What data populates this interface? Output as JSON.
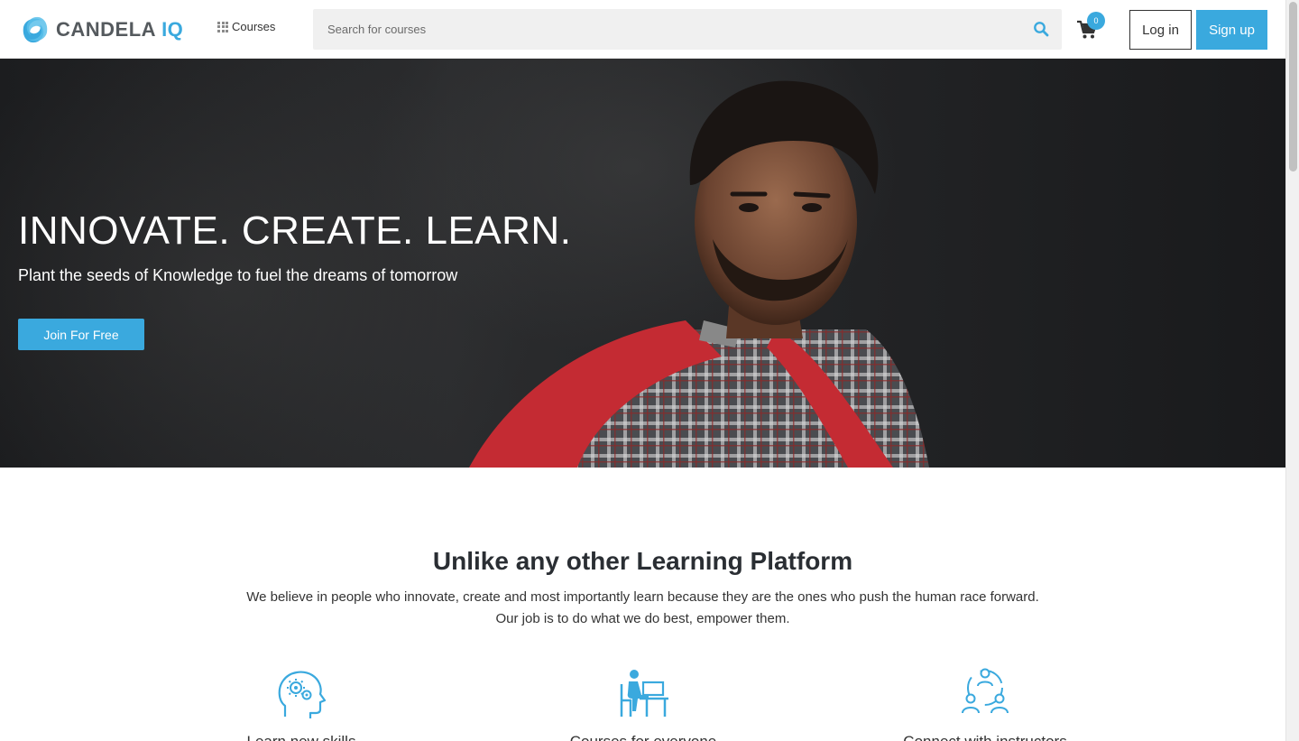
{
  "brand": {
    "name": "CANDELA",
    "suffix": "IQ",
    "accent": "#3aa9de",
    "text_color": "#555a5e"
  },
  "nav": {
    "courses_label": "Courses"
  },
  "search": {
    "placeholder": "Search for courses"
  },
  "cart": {
    "count": "0"
  },
  "auth": {
    "login_label": "Log in",
    "signup_label": "Sign up"
  },
  "hero": {
    "title": "INNOVATE. CREATE. LEARN.",
    "subtitle": "Plant the seeds of Knowledge to fuel the dreams of tomorrow",
    "cta_label": "Join For Free"
  },
  "about": {
    "title": "Unlike any other Learning Platform",
    "line1": "We believe in people who innovate, create and most importantly learn because they are the ones who push the human race forward.",
    "line2": "Our job is to do what we do best, empower them."
  },
  "features": [
    {
      "icon": "brain-gears-icon",
      "label": "Learn new skills"
    },
    {
      "icon": "student-desk-icon",
      "label": "Courses for everyone"
    },
    {
      "icon": "community-icon",
      "label": "Connect with instructors"
    }
  ]
}
